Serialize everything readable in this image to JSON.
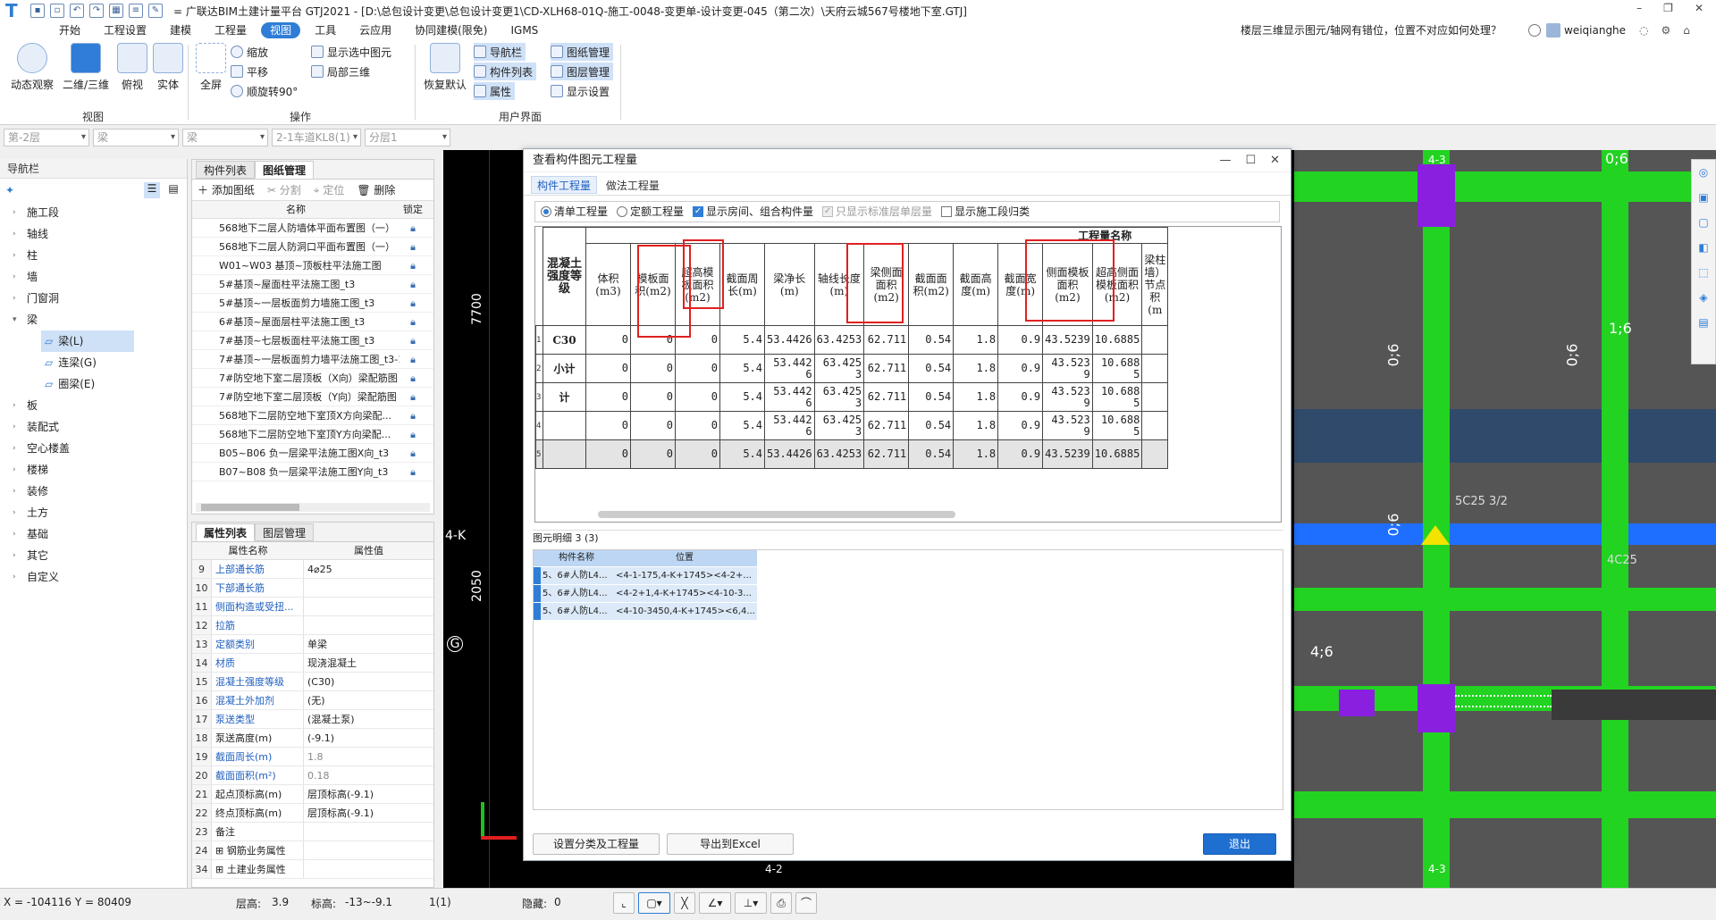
{
  "app": {
    "title": "= 广联达BIM土建计量平台 GTJ2021 - [D:\\总包设计变更\\总包设计变更1\\CD-XLH68-01Q-施工-0048-变更单-设计变更-045（第二次）\\天府云城567号楼地下室.GTJ]",
    "logo_letter": "T",
    "help_search": "楼层三维显示图元/轴网有错位，位置不对应如何处理？",
    "user": "weiqianghe",
    "brand_color": "#2f7dd6"
  },
  "ribbon_tabs": [
    "开始",
    "工程设置",
    "建模",
    "工程量",
    "视图",
    "工具",
    "云应用",
    "协同建模(限免)",
    "IGMS"
  ],
  "ribbon": {
    "view_group": {
      "label": "视图",
      "buttons": [
        "动态观察",
        "二维/三维",
        "俯视",
        "实体"
      ]
    },
    "op_group": {
      "label": "操作",
      "big": "全屏",
      "small": [
        "缩放",
        "平移",
        "顺旋转90°",
        "显示选中图元",
        "局部三维"
      ]
    },
    "ui_group": {
      "label": "用户界面",
      "big": "恢复默认",
      "small": [
        "导航栏",
        "图纸管理",
        "构件列表",
        "图层管理",
        "属性",
        "显示设置"
      ]
    }
  },
  "combos": [
    "第-2层",
    "梁",
    "梁",
    "2-1车道KL8(1)",
    "分层1"
  ],
  "nav": {
    "title": "导航栏",
    "items": [
      "施工段",
      "轴线",
      "柱",
      "墙",
      "门窗洞",
      "梁",
      "板",
      "装配式",
      "空心楼盖",
      "楼梯",
      "装修",
      "土方",
      "基础",
      "其它",
      "自定义"
    ],
    "sub_items": [
      "梁(L)",
      "连梁(G)",
      "圈梁(E)"
    ]
  },
  "drawing_panel": {
    "tabs": [
      "构件列表",
      "图纸管理"
    ],
    "toolbar": [
      "添加图纸",
      "分割",
      "定位",
      "删除"
    ],
    "col_name": "名称",
    "col_lock": "锁定",
    "rows": [
      "568地下二层人防墙体平面布置图（一）",
      "568地下二层人防洞口平面布置图（一）",
      "W01~W03 基顶~顶板柱平法施工图",
      "5#基顶~屋面柱平法施工图_t3",
      "5#基顶~一层板面剪力墙施工图_t3",
      "6#基顶~屋面层柱平法施工图_t3",
      "7#基顶~七层板面柱平法施工图_t3",
      "7#基顶~一层板面剪力墙平法施工图_t3-1",
      "7#防空地下室二层顶板（X向）梁配筋图",
      "7#防空地下室二层顶板（Y向）梁配筋图",
      "568地下二层防空地下室顶X方向梁配...",
      "568地下二层防空地下室顶Y方向梁配...",
      "B05~B06 负一层梁平法施工图X向_t3",
      "B07~B08 负一层梁平法施工图Y向_t3"
    ]
  },
  "prop_panel": {
    "tabs": [
      "属性列表",
      "图层管理"
    ],
    "col_name": "属性名称",
    "col_value": "属性值",
    "rows": [
      {
        "i": "9",
        "k": "上部通长筋",
        "v": "4⌀25",
        "blue": true
      },
      {
        "i": "10",
        "k": "下部通长筋",
        "v": "",
        "blue": true
      },
      {
        "i": "11",
        "k": "侧面构造或受扭...",
        "v": "",
        "blue": true
      },
      {
        "i": "12",
        "k": "拉筋",
        "v": "",
        "blue": true
      },
      {
        "i": "13",
        "k": "定额类别",
        "v": "单梁",
        "blue": true
      },
      {
        "i": "14",
        "k": "材质",
        "v": "现浇混凝土",
        "blue": true
      },
      {
        "i": "15",
        "k": "混凝土强度等级",
        "v": "(C30)",
        "blue": true
      },
      {
        "i": "16",
        "k": "混凝土外加剂",
        "v": "(无)",
        "blue": true
      },
      {
        "i": "17",
        "k": "泵送类型",
        "v": "(混凝土泵)",
        "blue": true
      },
      {
        "i": "18",
        "k": "泵送高度(m)",
        "v": "(-9.1)",
        "blue": false
      },
      {
        "i": "19",
        "k": "截面周长(m)",
        "v": "1.8",
        "blue": true,
        "gray": true
      },
      {
        "i": "20",
        "k": "截面面积(m²)",
        "v": "0.18",
        "blue": true,
        "gray": true
      },
      {
        "i": "21",
        "k": "起点顶标高(m)",
        "v": "层顶标高(-9.1)",
        "blue": false
      },
      {
        "i": "22",
        "k": "终点顶标高(m)",
        "v": "层顶标高(-9.1)",
        "blue": false
      },
      {
        "i": "23",
        "k": "备注",
        "v": "",
        "blue": false
      },
      {
        "i": "24",
        "k": "⊞ 钢筋业务属性",
        "v": "",
        "blue": false
      },
      {
        "i": "34",
        "k": "⊞ 土建业务属性",
        "v": "",
        "blue": false
      }
    ]
  },
  "canvas_labels": {
    "dim1": "7700",
    "dim2": "2050",
    "axis_k": "4-K",
    "axis_g": "G",
    "grid_marks": [
      "4-3",
      "0;6",
      "0;6",
      "0;6",
      "4;6",
      "0;6",
      "1;6",
      "4-3",
      "4-2"
    ],
    "beam_label1": "5C25 3/2",
    "beam_label2": "4C25"
  },
  "dialog": {
    "title": "查看构件图元工程量",
    "tabs": [
      "构件工程量",
      "做法工程量"
    ],
    "options": [
      {
        "label": "清单工程量",
        "type": "radio",
        "on": true
      },
      {
        "label": "定额工程量",
        "type": "radio",
        "on": false
      },
      {
        "label": "显示房间、组合构件量",
        "type": "check",
        "on": true
      },
      {
        "label": "只显示标准层单层量",
        "type": "check",
        "on": false,
        "disabled": true
      },
      {
        "label": "显示施工段归类",
        "type": "check",
        "on": false
      }
    ],
    "table": {
      "group_header": "工程量名称",
      "grade_header": "混凝土强度等级",
      "columns": [
        "体积(m3)",
        "模板面积(m2)",
        "超高模板面积(m2)",
        "截面周长(m)",
        "梁净长(m)",
        "轴线长度(m)",
        "梁侧面面积(m2)",
        "截面面积(m2)",
        "截面高度(m)",
        "截面宽度(m)",
        "侧面模板面积(m2)",
        "超高侧面模板面积(m2)",
        "梁柱墙）节点积(m"
      ],
      "rows": [
        {
          "idx": "1",
          "label": "C30",
          "vals": [
            "0",
            "0",
            "0",
            "5.4",
            "53.4426",
            "63.4253",
            "62.711",
            "0.54",
            "1.8",
            "0.9",
            "43.5239",
            "10.6885"
          ],
          "gray": false
        },
        {
          "idx": "2",
          "label": "小计",
          "vals": [
            "0",
            "0",
            "0",
            "5.4",
            "53.442 6",
            "63.425 3",
            "62.711",
            "0.54",
            "1.8",
            "0.9",
            "43.523 9",
            "10.688 5"
          ],
          "gray": false
        },
        {
          "idx": "3",
          "label": "计",
          "vals": [
            "0",
            "0",
            "0",
            "5.4",
            "53.442 6",
            "63.425 3",
            "62.711",
            "0.54",
            "1.8",
            "0.9",
            "43.523 9",
            "10.688 5"
          ],
          "gray": false
        },
        {
          "idx": "4",
          "label": "",
          "vals": [
            "0",
            "0",
            "0",
            "5.4",
            "53.442 6",
            "63.425 3",
            "62.711",
            "0.54",
            "1.8",
            "0.9",
            "43.523 9",
            "10.688 5"
          ],
          "gray": false
        },
        {
          "idx": "5",
          "label": "",
          "vals": [
            "0",
            "0",
            "0",
            "5.4",
            "53.4426",
            "63.4253",
            "62.711",
            "0.54",
            "1.8",
            "0.9",
            "43.5239",
            "10.6885"
          ],
          "gray": true
        }
      ]
    },
    "detail": {
      "title": "图元明细",
      "count": "3 (3)",
      "col_name": "构件名称",
      "col_pos": "位置",
      "rows": [
        {
          "name": "5、6#人防L4...",
          "pos": "<4-1-175,4-K+1745><4-2+..."
        },
        {
          "name": "5、6#人防L4...",
          "pos": "<4-2+1,4-K+1745><4-10-3..."
        },
        {
          "name": "5、6#人防L4...",
          "pos": "<4-10-3450,4-K+1745><6,4..."
        }
      ]
    },
    "buttons": {
      "settings": "设置分类及工程量",
      "export": "导出到Excel",
      "exit": "退出"
    }
  },
  "status": {
    "coords": "X = -104116 Y = 80409",
    "floor_height_label": "层高:",
    "floor_height": "3.9",
    "elev_label": "标高:",
    "elev": "-13~-9.1",
    "count": "1(1)",
    "hidden_label": "隐藏:",
    "hidden": "0"
  }
}
